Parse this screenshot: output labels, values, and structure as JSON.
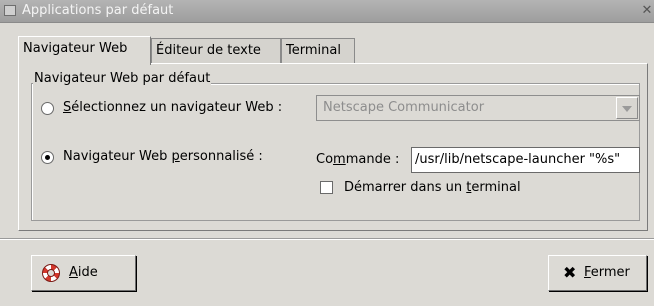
{
  "window": {
    "title": "Applications par défaut",
    "close_glyph": "✕",
    "title_icon": "window-menu-icon"
  },
  "tabs": [
    {
      "label": "Navigateur Web",
      "active": true
    },
    {
      "label": "Éditeur de texte",
      "active": false
    },
    {
      "label": "Terminal",
      "active": false
    }
  ],
  "frame": {
    "title": "Navigateur Web par défaut",
    "option_select": {
      "checked": false,
      "mnemonic": "S",
      "rest": "électionnez un navigateur Web :"
    },
    "browser_combo": {
      "value": "Netscape Communicator",
      "disabled": true
    },
    "option_custom": {
      "checked": true,
      "before": "Navigateur Web ",
      "mnemonic": "p",
      "after": "ersonnalisé :"
    },
    "command": {
      "label_before": "Co",
      "mnemonic": "m",
      "label_after": "mande :",
      "value": "/usr/lib/netscape-launcher \"%s\""
    },
    "terminal_check": {
      "checked": false,
      "before": "Démarrer dans un ",
      "mnemonic": "t",
      "after": "erminal"
    }
  },
  "buttons": {
    "help": {
      "mnemonic": "A",
      "rest": "ide",
      "icon": "lifebuoy-icon"
    },
    "close": {
      "mnemonic": "F",
      "rest": "ermer",
      "icon": "close-x-icon",
      "glyph": "✖"
    }
  },
  "colors": {
    "background": "#dcdad5",
    "titlebar": "#a8a8a8",
    "disabled_text": "#8d8d8d"
  }
}
